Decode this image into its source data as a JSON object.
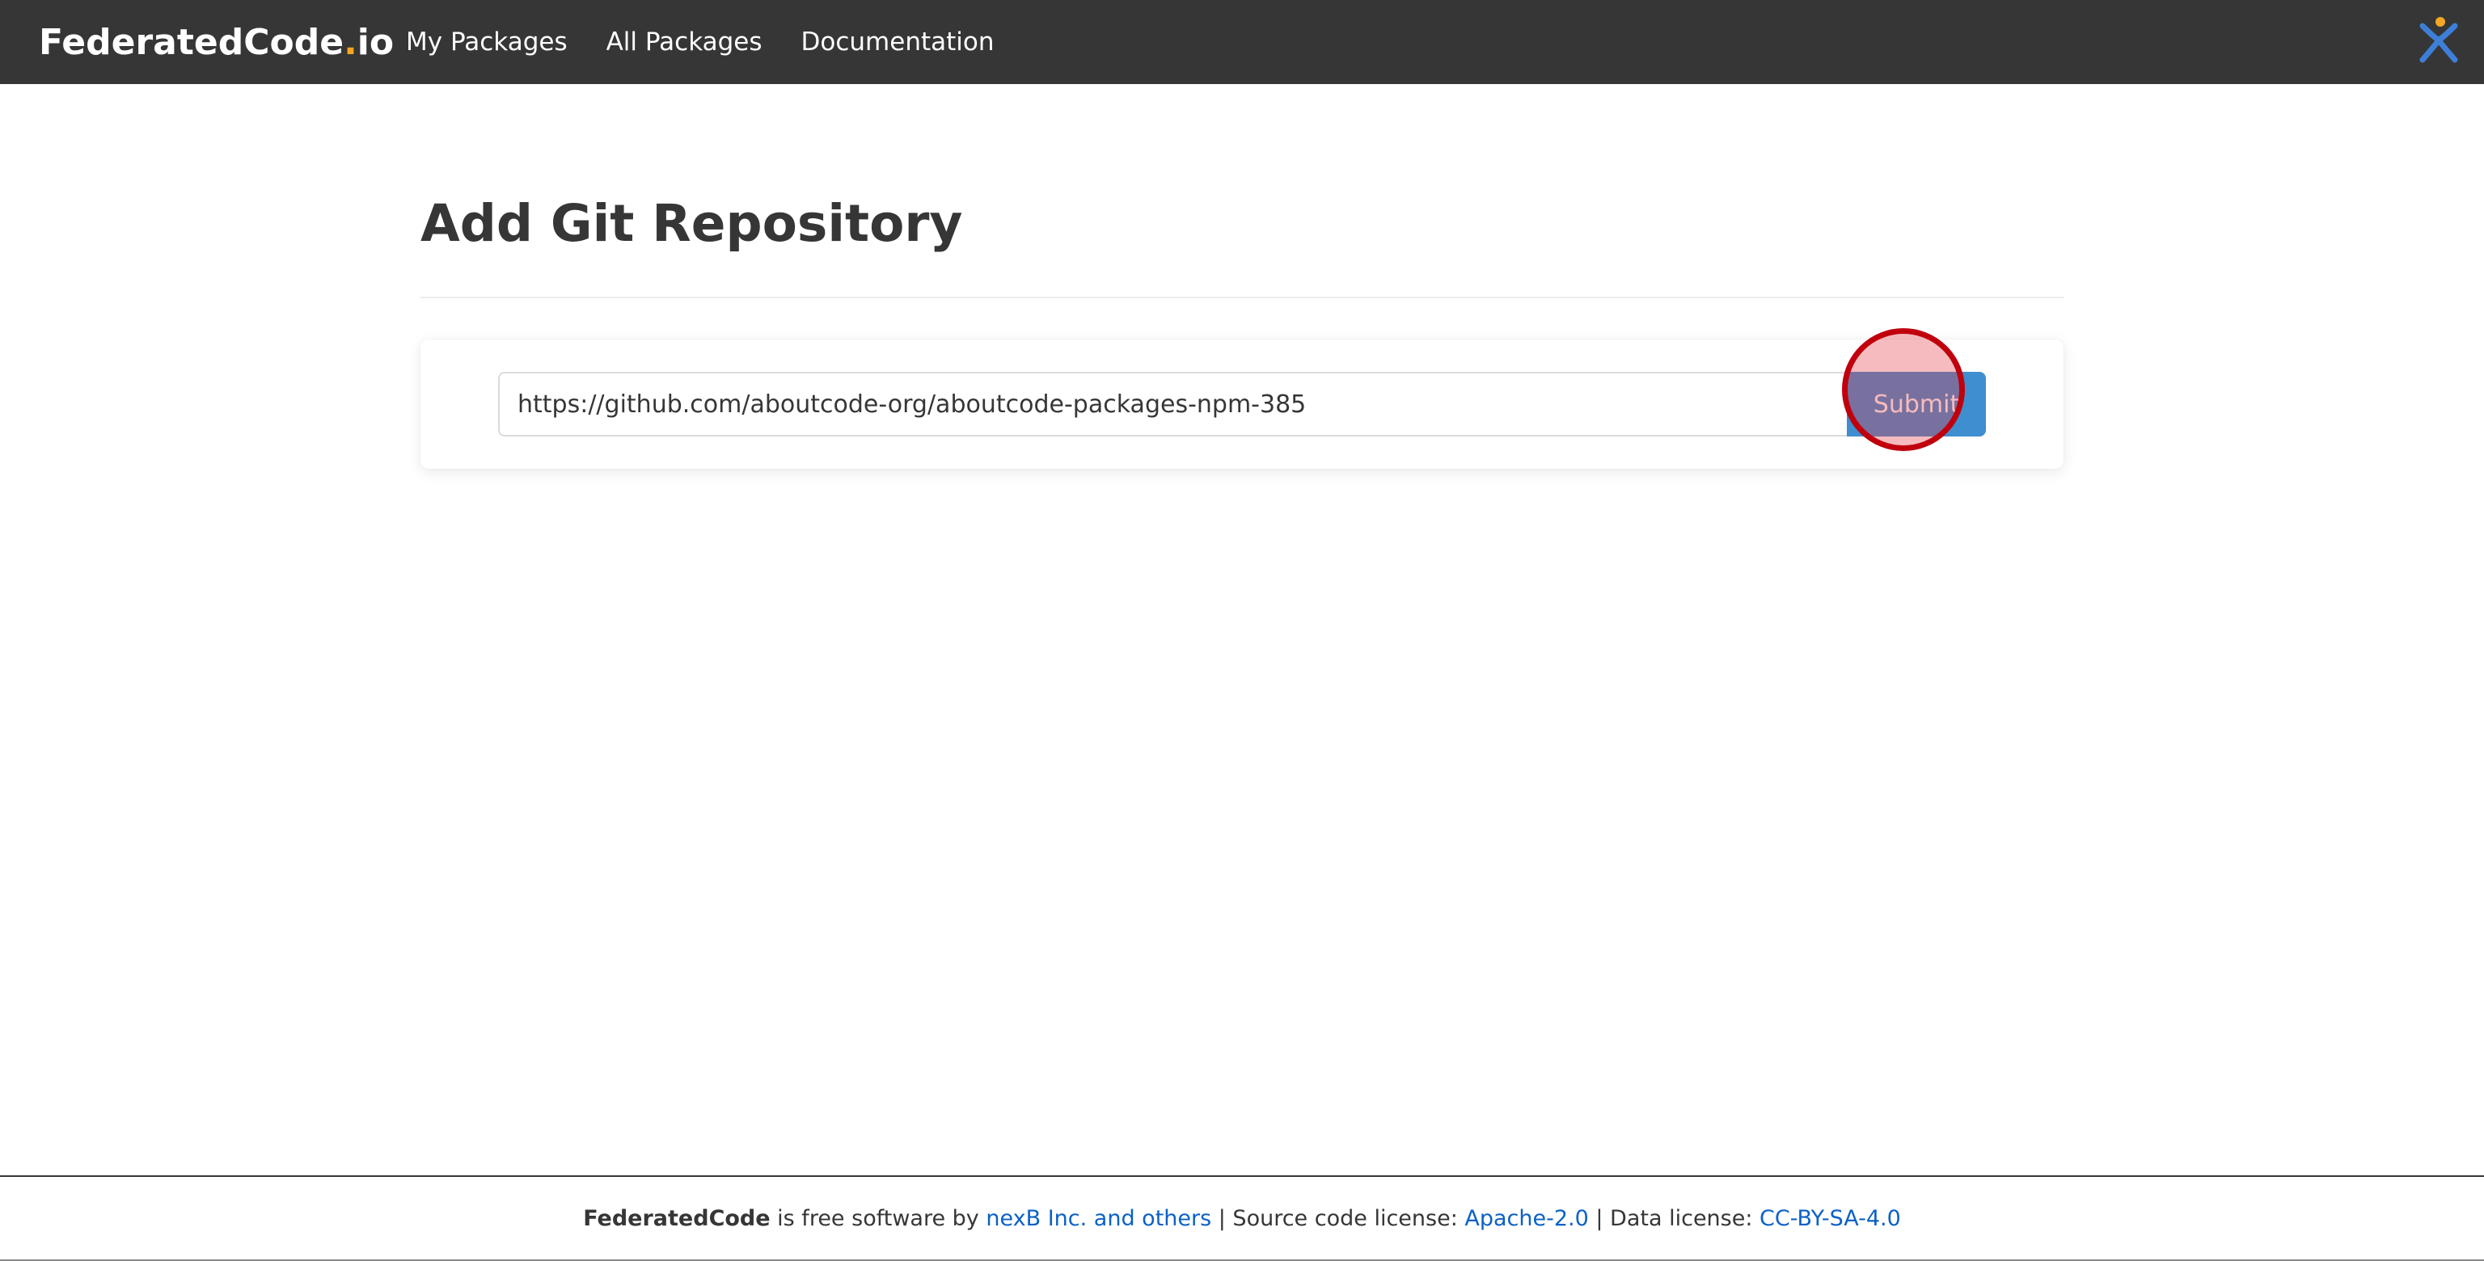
{
  "navbar": {
    "brand_main": "FederatedCode",
    "brand_dot": ".",
    "brand_tld": "io",
    "links": [
      {
        "label": "My Packages"
      },
      {
        "label": "All Packages"
      },
      {
        "label": "Documentation"
      }
    ],
    "logo_icon": "aboutcode-logo-icon"
  },
  "main": {
    "title": "Add Git Repository",
    "repo_input": {
      "value": "https://github.com/aboutcode-org/aboutcode-packages-npm-385"
    },
    "submit_label": "Submit"
  },
  "footer": {
    "product": "FederatedCode",
    "text1": " is free software by ",
    "author_link": "nexB Inc. and others",
    "text2": " | Source code license: ",
    "code_license": "Apache-2.0",
    "text3": " | Data license: ",
    "data_license": "CC-BY-SA-4.0"
  },
  "colors": {
    "navbar_bg": "#363636",
    "brand_dot": "#f5a623",
    "primary_button": "#3e8ed0",
    "link": "#0b61c6",
    "click_marker": "#c0000d"
  }
}
